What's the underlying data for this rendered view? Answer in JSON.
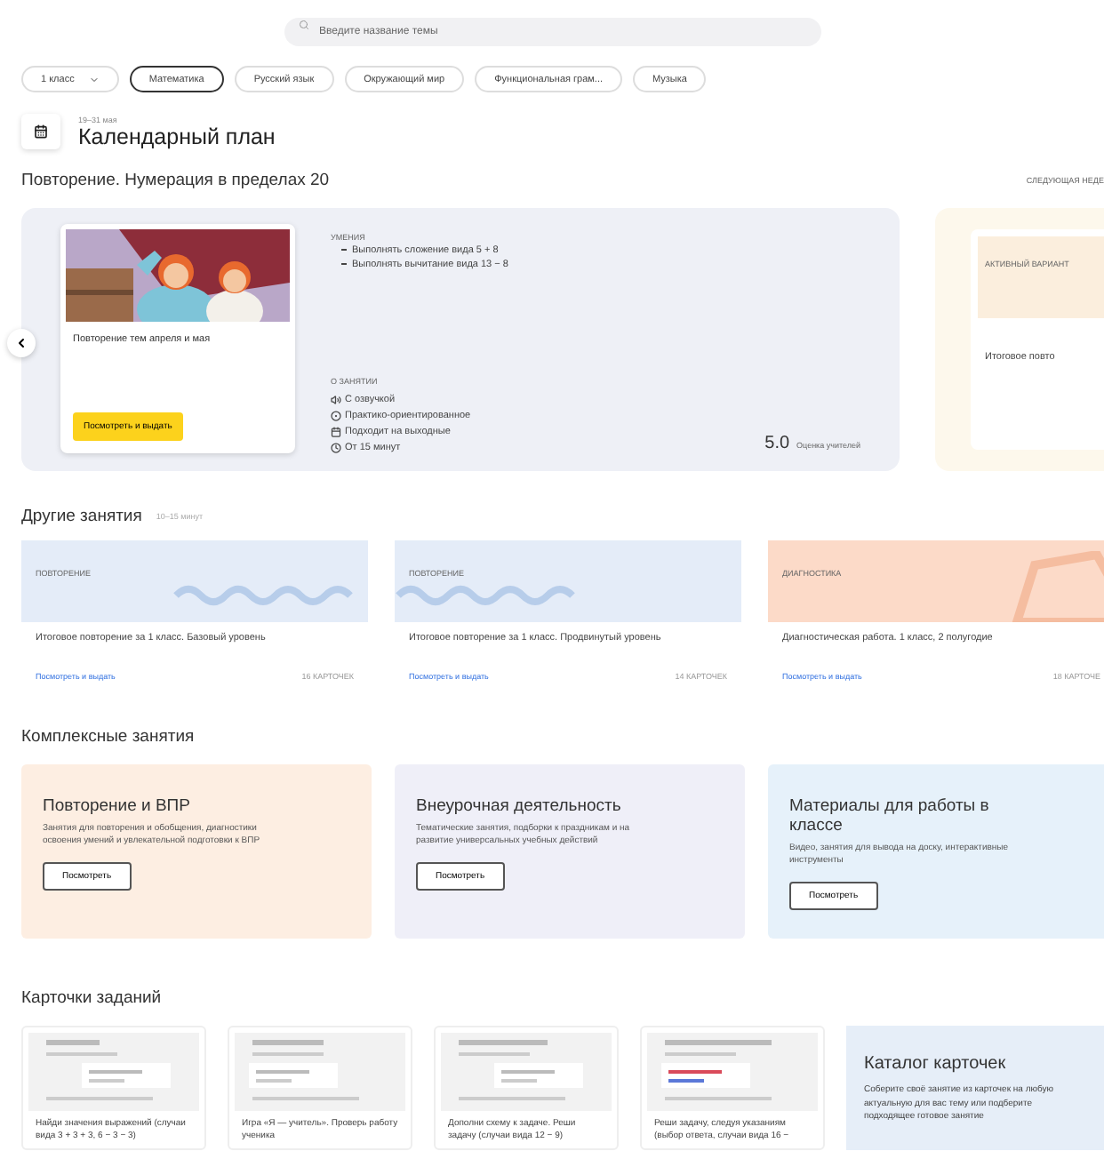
{
  "search": {
    "placeholder": "Введите название темы"
  },
  "filters": [
    {
      "kind": "dropdown",
      "label": "1 класс",
      "selected": false
    },
    {
      "kind": "chip",
      "label": "Математика",
      "selected": true
    },
    {
      "kind": "chip",
      "label": "Русский язык",
      "selected": false
    },
    {
      "kind": "chip",
      "label": "Окружающий мир",
      "selected": false
    },
    {
      "kind": "chip",
      "label": "Функциональная грам...",
      "selected": false
    },
    {
      "kind": "chip",
      "label": "Музыка",
      "selected": false
    }
  ],
  "header": {
    "caption": "19–31 мая",
    "title": "Календарный план"
  },
  "week": {
    "title": "Повторение. Нумерация в пределах 20",
    "next_link": "СЛЕДУЮЩАЯ НЕДЕ"
  },
  "lesson": {
    "card_title": "Повторение тем апреля и мая",
    "button": "Посмотреть и выдать",
    "skills_label": "УМЕНИЯ",
    "skills": [
      "Выполнять сложение вида 5 + 8",
      "Выполнять вычитание вида 13 − 8"
    ],
    "about_label": "О ЗАНЯТИИ",
    "features": [
      {
        "kind": "audio",
        "text": "С озвучкой"
      },
      {
        "kind": "practice",
        "text": "Практико-ориентированное"
      },
      {
        "kind": "weekend",
        "text": "Подходит на выходные"
      },
      {
        "kind": "time",
        "text": "От 15 минут"
      }
    ],
    "rating": "5.0",
    "rating_label": "Оценка учителей"
  },
  "next_lesson": {
    "label": "АКТИВНЫЙ ВАРИАНТ",
    "title": "Итоговое повто"
  },
  "other": {
    "title": "Другие занятия",
    "duration": "10–15 минут",
    "cards": [
      {
        "kind": "repeat",
        "color": "#e4ecf8",
        "tag": "ПОВТОРЕНИЕ",
        "title": "Итоговое повторение за 1 класс. Базовый уровень",
        "link": "Посмотреть и выдать",
        "count": "16 КАРТОЧЕК"
      },
      {
        "kind": "repeat",
        "color": "#e4ecf8",
        "tag": "ПОВТОРЕНИЕ",
        "title": "Итоговое повторение за 1 класс. Продвинутый уровень",
        "link": "Посмотреть и выдать",
        "count": "14 КАРТОЧЕК"
      },
      {
        "kind": "diagnostic",
        "color": "#fcdac8",
        "tag": "ДИАГНОСТИКА",
        "title": "Диагностическая работа. 1 класс, 2 полугодие",
        "link": "Посмотреть и выдать",
        "count": "18 КАРТОЧЕ"
      }
    ]
  },
  "complex": {
    "title": "Комплексные занятия",
    "cards": [
      {
        "color": "#fdeee2",
        "title": "Повторение и ВПР",
        "text": "Занятия для повторения и обобщения, диагностики освоения умений и увлекательной подготовки к ВПР",
        "button": "Посмотреть"
      },
      {
        "color": "#efeff8",
        "title": "Внеурочная деятельность",
        "text": "Тематические занятия, подборки к праздникам и на развитие универсальных учебных действий",
        "button": "Посмотреть"
      },
      {
        "color": "#e6f1fa",
        "title": "Материалы для работы в классе",
        "text": "Видео, занятия для вывода на доску, интерактивные инструменты",
        "button": "Посмотреть"
      }
    ]
  },
  "tasks": {
    "title": "Карточки заданий",
    "cards": [
      {
        "text": "Найди значения выражений (случаи вида 3 + 3 + 3, 6 − 3 − 3)"
      },
      {
        "text": "Игра «Я — учитель». Проверь работу ученика"
      },
      {
        "text": "Дополни схему к задаче. Реши задачу (случаи вида 12 − 9)"
      },
      {
        "text": "Реши задачу, следуя указаниям (выбор ответа, случаи вида 16 −"
      }
    ],
    "catalog": {
      "title": "Каталог карточек",
      "text": "Соберите своё занятие из карточек на любую актуальную для вас тему или подберите подходящее готовое занятие"
    }
  }
}
